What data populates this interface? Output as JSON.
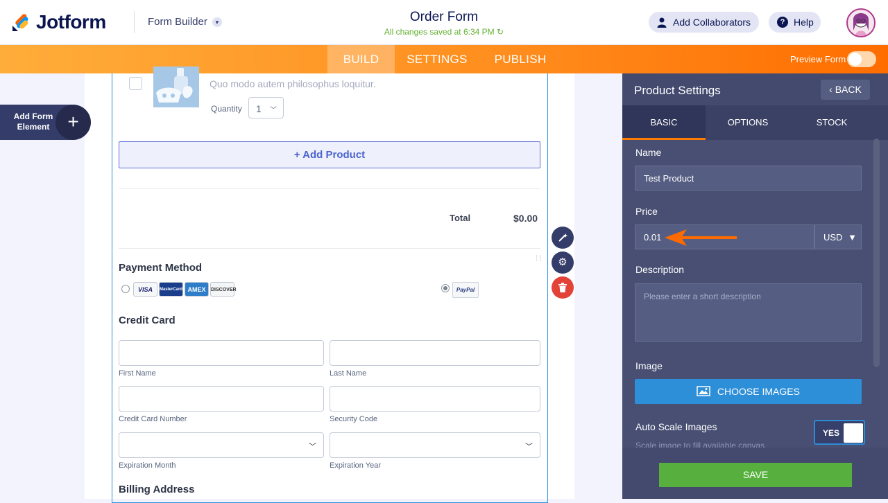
{
  "header": {
    "logo_text": "Jotform",
    "form_builder_label": "Form Builder",
    "form_title": "Order Form",
    "save_status": "All changes saved at 6:34 PM",
    "add_collaborators_label": "Add Collaborators",
    "help_label": "Help"
  },
  "nav": {
    "tabs": [
      {
        "label": "BUILD",
        "active": true
      },
      {
        "label": "SETTINGS"
      },
      {
        "label": "PUBLISH"
      }
    ],
    "preview_label": "Preview Form",
    "preview_on": false
  },
  "builder": {
    "add_element_label": "Add Form Element",
    "product": {
      "description": "Quo modo autem philosophus loquitur.",
      "quantity_label": "Quantity",
      "quantity_value": "1"
    },
    "add_product_label": "+ Add Product",
    "total_label": "Total",
    "total_value": "$0.00",
    "payment_method_label": "Payment Method",
    "cards": [
      "VISA",
      "MasterCard",
      "AMEX",
      "DISCOVER"
    ],
    "paypal_label": "PayPal",
    "credit_card_label": "Credit Card",
    "fields": {
      "first_name": "First Name",
      "last_name": "Last Name",
      "card_number": "Credit Card Number",
      "security_code": "Security Code",
      "exp_month": "Expiration Month",
      "exp_year": "Expiration Year"
    },
    "billing_label": "Billing Address"
  },
  "panel": {
    "title": "Product Settings",
    "back_label": "BACK",
    "tabs": [
      {
        "label": "BASIC",
        "active": true
      },
      {
        "label": "OPTIONS"
      },
      {
        "label": "STOCK"
      }
    ],
    "name_label": "Name",
    "name_value": "Test Product",
    "price_label": "Price",
    "price_value": "0.01",
    "currency": "USD",
    "description_label": "Description",
    "description_placeholder": "Please enter a short description",
    "image_label": "Image",
    "choose_images_label": "CHOOSE IMAGES",
    "auto_scale_label": "Auto Scale Images",
    "auto_scale_hint": "Scale image to fill available canvas.",
    "auto_scale_value": "YES",
    "save_label": "SAVE"
  },
  "colors": {
    "accent": "#ff7c00",
    "brand_navy": "#0a1551",
    "panel_bg": "#484f73",
    "save_green": "#57b03e",
    "selection_blue": "#2b8fdd"
  }
}
